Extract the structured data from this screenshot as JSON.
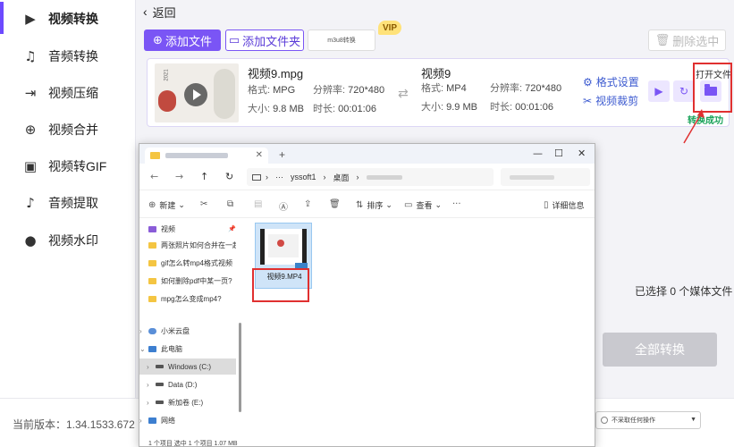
{
  "sidebar": {
    "items": [
      {
        "label": "视频转换",
        "icon": "video-convert-icon",
        "glyph": "▶"
      },
      {
        "label": "音频转换",
        "icon": "audio-convert-icon",
        "glyph": "♫"
      },
      {
        "label": "视频压缩",
        "icon": "video-compress-icon",
        "glyph": "⇥"
      },
      {
        "label": "视频合并",
        "icon": "video-merge-icon",
        "glyph": "⊕"
      },
      {
        "label": "视频转GIF",
        "icon": "gif-icon",
        "glyph": "▣"
      },
      {
        "label": "音频提取",
        "icon": "audio-extract-icon",
        "glyph": "♪"
      },
      {
        "label": "视频水印",
        "icon": "watermark-icon",
        "glyph": "●"
      }
    ]
  },
  "topbar": {
    "back_label": "返回",
    "add_file": "添加文件",
    "add_folder": "添加文件夹",
    "m3u8": "m3u8转换",
    "vip": "VIP",
    "delete_selected": "删除选中"
  },
  "file": {
    "src_name": "视频9.mpg",
    "src_format_label": "格式:",
    "src_format": "MPG",
    "src_size_label": "大小:",
    "src_size": "9.8 MB",
    "src_res_label": "分辨率:",
    "src_res": "720*480",
    "src_dur_label": "时长:",
    "src_dur": "00:01:06",
    "dst_name": "视频9",
    "dst_format_label": "格式:",
    "dst_format": "MP4",
    "dst_size_label": "大小:",
    "dst_size": "9.9 MB",
    "dst_res_label": "分辨率:",
    "dst_res": "720*480",
    "dst_dur_label": "时长:",
    "dst_dur": "00:01:06",
    "format_settings": "格式设置",
    "video_crop": "视频裁剪",
    "open_file": "打开文件",
    "convert_done": "转换成功",
    "thumb_year": "2021"
  },
  "status": {
    "selected_count": "已选择 0 个媒体文件",
    "convert_all": "全部转换",
    "version": "当前版本：1.34.1533.672",
    "after_action": "不采取任何操作"
  },
  "explorer": {
    "address": [
      "yssoft1",
      "桌面"
    ],
    "toolbar": {
      "new": "新建",
      "sort": "排序",
      "view": "查看",
      "details": "详细信息"
    },
    "sidebar": [
      {
        "label": "视频",
        "kind": "video"
      },
      {
        "label": "两张照片如何合并在一起",
        "kind": "folder"
      },
      {
        "label": "gif怎么转mp4格式视频",
        "kind": "folder"
      },
      {
        "label": "如何删除pdf中某一页?",
        "kind": "folder"
      },
      {
        "label": "mpg怎么变成mp4?",
        "kind": "folder"
      },
      {
        "label": "小米云盘",
        "kind": "cloud"
      },
      {
        "label": "此电脑",
        "kind": "pc"
      },
      {
        "label": "Windows (C:)",
        "kind": "drive"
      },
      {
        "label": "Data (D:)",
        "kind": "drive"
      },
      {
        "label": "新加卷 (E:)",
        "kind": "drive"
      },
      {
        "label": "网络",
        "kind": "network"
      }
    ],
    "file_tile": "视频9.MP4",
    "status_bar": "1 个项目    选中 1 个项目 1.07 MB"
  }
}
